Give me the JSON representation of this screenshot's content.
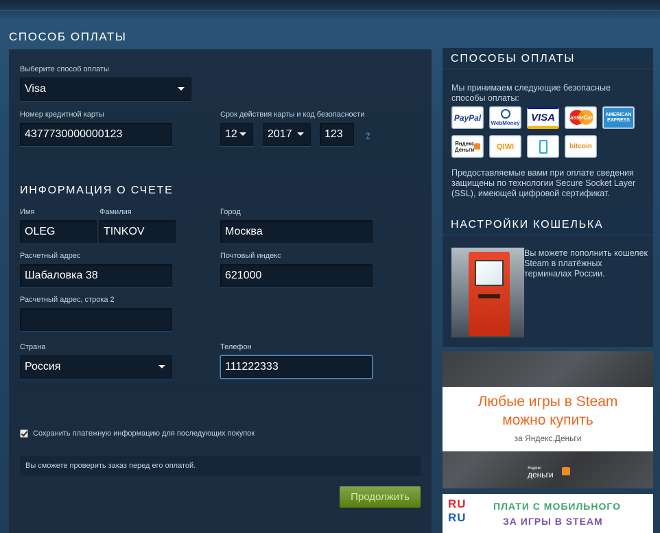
{
  "page_title": "СПОСОБ ОПЛАТЫ",
  "payment": {
    "method_label": "Выберите способ оплаты",
    "method_value": "Visa",
    "card_number_label": "Номер кредитной карты",
    "card_number_value": "4377730000000123",
    "expiry_label": "Срок действия карты и код безопасности",
    "expiry_month": "12",
    "expiry_year": "2017",
    "cvv_value": "123",
    "help_link": "?"
  },
  "billing": {
    "section_title": "ИНФОРМАЦИЯ О СЧЕТЕ",
    "first_name_label": "Имя",
    "first_name_value": "OLEG",
    "last_name_label": "Фамилия",
    "last_name_value": "TINKOV",
    "city_label": "Город",
    "city_value": "Москва",
    "address_label": "Расчетный адрес",
    "address_value": "Шабаловка 38",
    "zip_label": "Почтовый индекс",
    "zip_value": "621000",
    "address2_label": "Расчетный адрес, строка 2",
    "address2_value": "",
    "country_label": "Страна",
    "country_value": "Россия",
    "phone_label": "Телефон",
    "phone_value": "111222333"
  },
  "save_info_label": "Сохранить платежную информацию для последующих покупок",
  "notice": "Вы сможете проверить заказ перед его оплатой.",
  "continue_label": "Продолжить",
  "sidebar": {
    "methods_title": "СПОСОБЫ ОПЛАТЫ",
    "methods_text": "Мы принимаем следующие безопасные способы оплаты:",
    "logos": [
      "PayPal",
      "WebMoney",
      "VISA",
      "MasterCard",
      "AMERICAN EXPRESS",
      "Яндекс Деньги",
      "QIWI",
      "mobile",
      "bitcoin"
    ],
    "ssl_text": "Предоставляемые вами при оплате сведения защищены по технологии Secure Socket Layer (SSL), имеющей цифровой сертификат.",
    "wallet_title": "НАСТРОЙКИ КОШЕЛЬКА",
    "wallet_text": "Вы можете пополнить кошелек Steam в платёжных терминалах России."
  },
  "banner_yandex": {
    "line1": "Любые игры в Steam",
    "line2": "можно купить",
    "line3": "за Яндекс.Деньги",
    "logo_small": "Яндекс",
    "logo_big": "деньги"
  },
  "banner_ruru": {
    "logo_line1": "RU",
    "logo_line2": "RU",
    "line1": "ПЛАТИ С МОБИЛЬНОГО",
    "line2": "ЗА ИГРЫ В STEAM"
  },
  "colors": {
    "accent_green": "#5c7e10",
    "focus_blue": "#5b87b4",
    "yandex_orange": "#e8681e"
  }
}
